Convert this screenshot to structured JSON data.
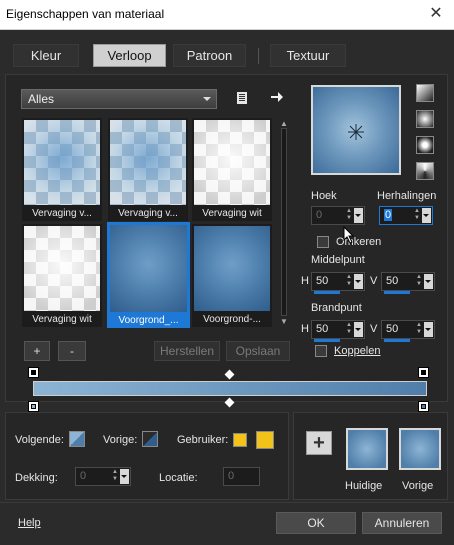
{
  "window": {
    "title": "Eigenschappen van materiaal",
    "close_glyph": "✕"
  },
  "tabs": [
    {
      "label": "Kleur",
      "active": false
    },
    {
      "label": "Verloop",
      "active": true
    },
    {
      "label": "Patroon",
      "active": false
    },
    {
      "label": "Textuur",
      "active": false
    }
  ],
  "category": {
    "selected": "Alles"
  },
  "gradients": [
    {
      "label": "Vervaging v...",
      "style": "checker-blue",
      "selected": false
    },
    {
      "label": "Vervaging v...",
      "style": "checker-blue",
      "selected": false
    },
    {
      "label": "Vervaging wit",
      "style": "checker-white",
      "selected": false
    },
    {
      "label": "Vervaging wit",
      "style": "checker-white",
      "selected": false
    },
    {
      "label": "Voorgrond_...",
      "style": "solid-blue",
      "selected": true
    },
    {
      "label": "Voorgrond-...",
      "style": "solid-blue",
      "selected": false
    }
  ],
  "list_buttons": {
    "add": "+",
    "remove": "-",
    "restore": "Herstellen",
    "save": "Opslaan"
  },
  "props": {
    "angle_label": "Hoek",
    "angle_value": "0",
    "repeats_label": "Herhalingen",
    "repeats_value": "0",
    "invert_label": "Omkeren",
    "center_label": "Middelpunt",
    "center_h_label": "H",
    "center_h": "50",
    "center_v_label": "V",
    "center_v": "50",
    "focal_label": "Brandpunt",
    "focal_h_label": "H",
    "focal_h": "50",
    "focal_v_label": "V",
    "focal_v": "50",
    "link_label": "Koppelen"
  },
  "stops": {
    "next_label": "Volgende:",
    "prev_label": "Vorige:",
    "user_label": "Gebruiker:",
    "opacity_label": "Dekking:",
    "opacity_value": "0",
    "location_label": "Locatie:",
    "location_value": "0"
  },
  "swatches": {
    "add_glyph": "+",
    "current_label": "Huidige",
    "previous_label": "Vorige"
  },
  "footer": {
    "help": "Help",
    "ok": "OK",
    "cancel": "Annuleren"
  },
  "colors": {
    "gradient_start": "#8db4d4",
    "gradient_end": "#4f7ea9",
    "user_color": "#f2c318",
    "selection": "#1d78d6"
  }
}
